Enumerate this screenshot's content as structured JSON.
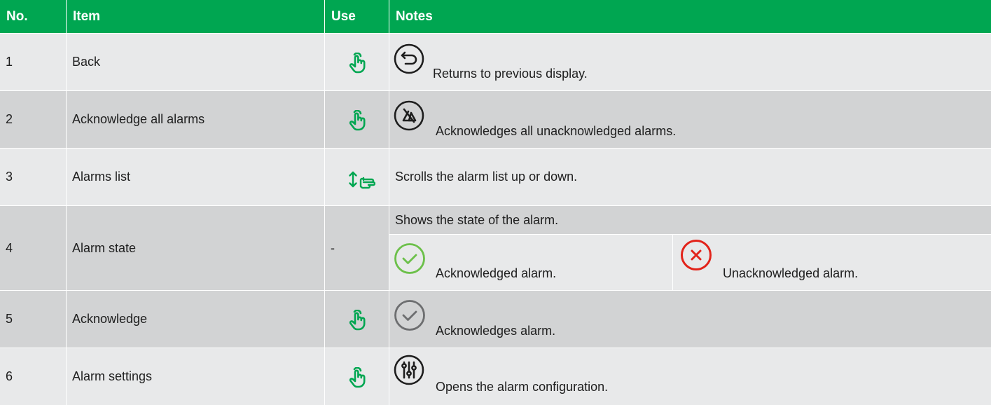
{
  "header": {
    "no": "No.",
    "item": "Item",
    "use": "Use",
    "notes": "Notes"
  },
  "rows": [
    {
      "no": "1",
      "item": "Back",
      "use_icon": "tap-hand-icon",
      "note_icon": "back-arrow-icon",
      "note": "Returns to previous display."
    },
    {
      "no": "2",
      "item": "Acknowledge all alarms",
      "use_icon": "tap-hand-icon",
      "note_icon": "acknowledge-all-icon",
      "note": "Acknowledges all unacknowledged alarms."
    },
    {
      "no": "3",
      "item": "Alarms list",
      "use_icon": "scroll-hand-icon",
      "note": "Scrolls the alarm list up or down."
    },
    {
      "no": "4",
      "item": "Alarm state",
      "use": "-",
      "note": "Shows the state of the alarm.",
      "states": [
        {
          "icon": "green-check-icon",
          "label": "Acknowledged alarm."
        },
        {
          "icon": "red-x-icon",
          "label": "Unacknowledged alarm."
        }
      ]
    },
    {
      "no": "5",
      "item": "Acknowledge",
      "use_icon": "tap-hand-icon",
      "note_icon": "grey-check-icon",
      "note": "Acknowledges alarm."
    },
    {
      "no": "6",
      "item": "Alarm settings",
      "use_icon": "tap-hand-icon",
      "note_icon": "settings-sliders-icon",
      "note": "Opens the alarm configuration."
    }
  ],
  "colors": {
    "header": "#00a651",
    "row_light": "#e8e9ea",
    "row_dark": "#d2d3d4",
    "ack_green": "#6cc04a",
    "unack_red": "#e2231a",
    "neutral_grey": "#6d6e70"
  }
}
